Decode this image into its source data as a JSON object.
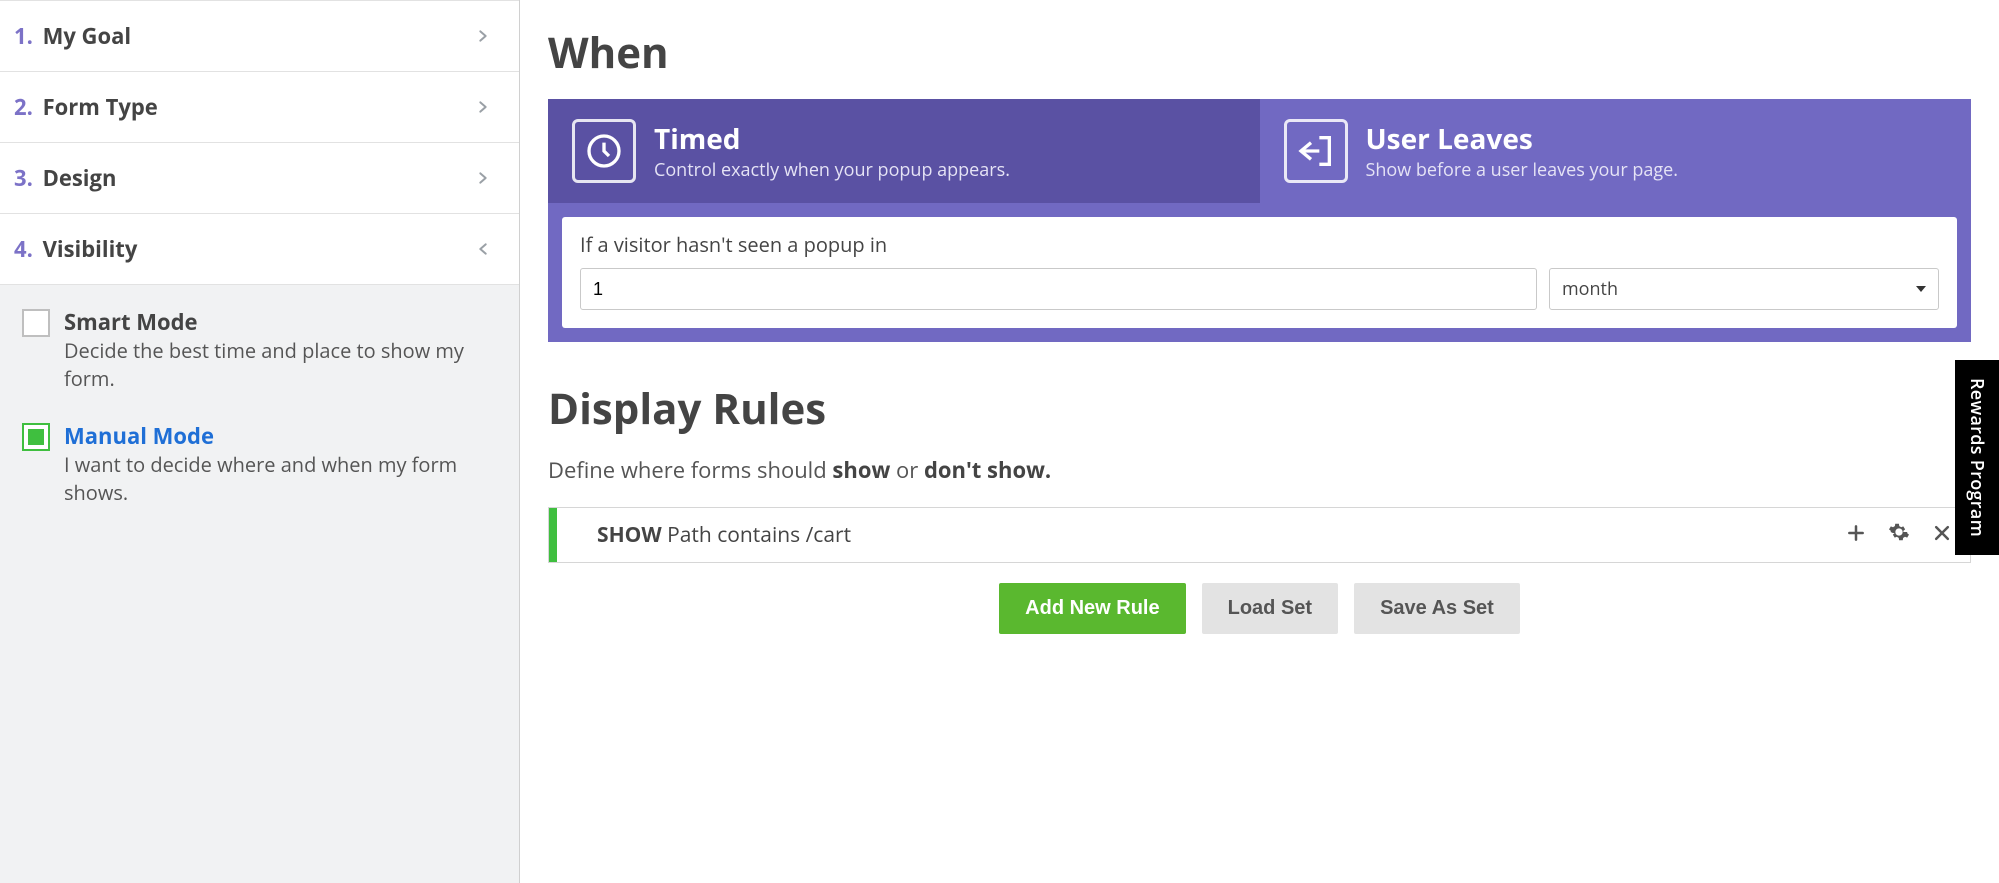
{
  "sidebar": {
    "steps": [
      {
        "num": "1.",
        "label": "My Goal"
      },
      {
        "num": "2.",
        "label": "Form Type"
      },
      {
        "num": "3.",
        "label": "Design"
      },
      {
        "num": "4.",
        "label": "Visibility"
      }
    ],
    "modes": {
      "smart": {
        "title": "Smart Mode",
        "desc": "Decide the best time and place to show my form."
      },
      "manual": {
        "title": "Manual Mode",
        "desc": "I want to decide where and when my form shows."
      }
    }
  },
  "main": {
    "when_heading": "When",
    "tabs": {
      "timed": {
        "title": "Timed",
        "desc": "Control exactly when your popup appears."
      },
      "leaves": {
        "title": "User Leaves",
        "desc": "Show before a user leaves your page."
      }
    },
    "condition": {
      "label": "If a visitor hasn't seen a popup in",
      "value": "1",
      "unit": "month"
    },
    "rules_heading": "Display Rules",
    "rules_intro_pre": "Define where forms should ",
    "rules_intro_show": "show",
    "rules_intro_mid": " or ",
    "rules_intro_dont": "don't show.",
    "rule1": {
      "action": "SHOW",
      "text": " Path contains /cart"
    },
    "buttons": {
      "add": "Add New Rule",
      "load": "Load Set",
      "save": "Save As Set"
    }
  },
  "rewards_label": "Rewards Program"
}
